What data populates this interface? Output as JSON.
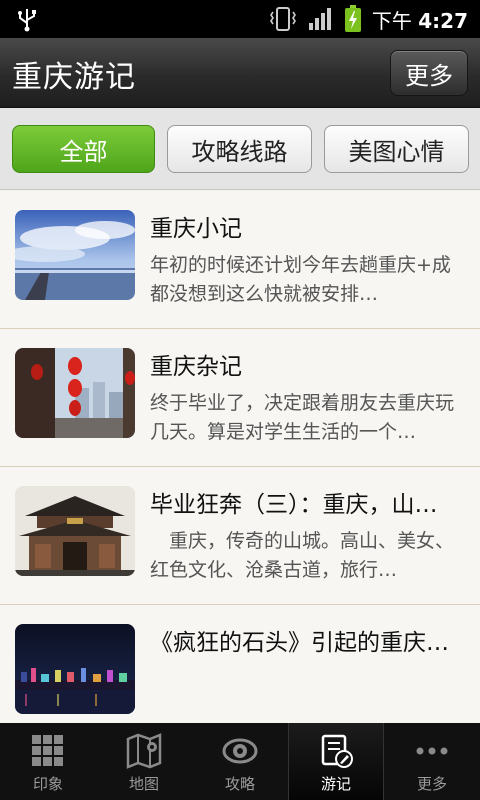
{
  "status_bar": {
    "time_prefix": "下午",
    "time": "4:27",
    "icons": [
      "usb-icon",
      "vibrate-icon",
      "signal-icon",
      "battery-charging-icon"
    ]
  },
  "header": {
    "title": "重庆游记",
    "more_label": "更多"
  },
  "filters": [
    {
      "label": "全部",
      "active": true
    },
    {
      "label": "攻略线路",
      "active": false
    },
    {
      "label": "美图心情",
      "active": false
    }
  ],
  "items": [
    {
      "title": "重庆小记",
      "summary": "年初的时候还计划今年去趟重庆+成都没想到这么快就被安排…",
      "thumb": "sky-pier-photo"
    },
    {
      "title": "重庆杂记",
      "summary": "终于毕业了，决定跟着朋友去重庆玩几天。算是对学生生活的一个…",
      "thumb": "red-lanterns-photo"
    },
    {
      "title": "毕业狂奔（三）：重庆，山…",
      "summary": "　重庆，传奇的山城。高山、美女、红色文化、沧桑古道，旅行…",
      "thumb": "ancient-gate-photo"
    },
    {
      "title": "《疯狂的石头》引起的重庆…",
      "summary": "",
      "thumb": "night-city-photo"
    }
  ],
  "bottom_nav": [
    {
      "label": "印象",
      "icon": "grid-icon",
      "active": false
    },
    {
      "label": "地图",
      "icon": "map-icon",
      "active": false
    },
    {
      "label": "攻略",
      "icon": "eye-icon",
      "active": false
    },
    {
      "label": "游记",
      "icon": "notebook-icon",
      "active": true
    },
    {
      "label": "更多",
      "icon": "more-dots-icon",
      "active": false
    }
  ],
  "colors": {
    "accent_green": "#5cb324",
    "title_bar": "#2b2b2b",
    "list_bg": "#f7f6f2"
  }
}
